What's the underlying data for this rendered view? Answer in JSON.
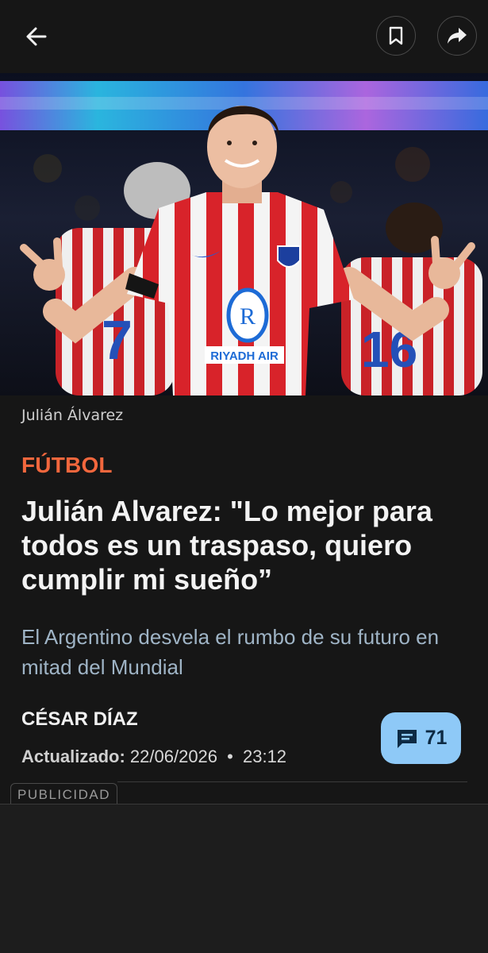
{
  "topbar": {
    "back_icon": "arrow-left-icon",
    "bookmark_icon": "bookmark-icon",
    "share_icon": "share-arrow-icon"
  },
  "hero": {
    "caption": "Julián Álvarez",
    "jersey_sponsor": "RIYADH AIR",
    "colors": {
      "stripe_red": "#d8232a",
      "stripe_white": "#f4f4f4"
    }
  },
  "article": {
    "section": "FÚTBOL",
    "headline": "Julián Alvarez: \"Lo mejor para todos es un traspaso, quiero cumplir mi sueño”",
    "subtitle": "El Argentino desvela el rumbo de su futuro en mitad del Mundial",
    "author": "CÉSAR DÍAZ",
    "updated_label": "Actualizado:",
    "updated_date": "22/06/2026",
    "updated_separator": "•",
    "updated_time": "23:12"
  },
  "comments": {
    "icon": "comment-icon",
    "count": "71",
    "color": "#8ec9f7"
  },
  "ad": {
    "label": "PUBLICIDAD"
  },
  "theme": {
    "background": "#161616",
    "accent": "#f2673d",
    "subtitle_color": "#9fb4c6"
  }
}
